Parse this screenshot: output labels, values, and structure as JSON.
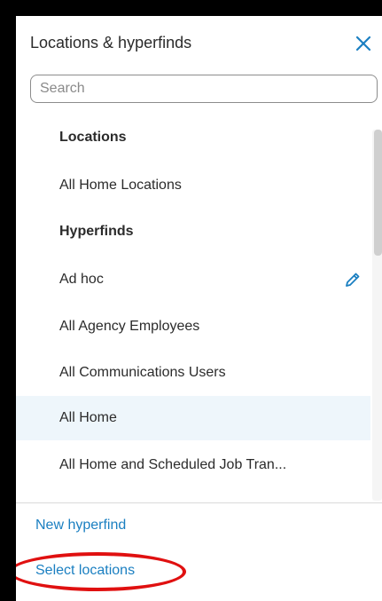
{
  "panel": {
    "title": "Locations & hyperfinds",
    "close_icon": "close-icon"
  },
  "search": {
    "placeholder": "Search",
    "value": ""
  },
  "list": {
    "locations_heading": "Locations",
    "all_home_locations": "All Home Locations",
    "hyperfinds_heading": "Hyperfinds",
    "ad_hoc": "Ad hoc",
    "ad_hoc_edit_icon": "pencil-icon",
    "all_agency_employees": "All Agency Employees",
    "all_communications_users": "All Communications Users",
    "all_home": "All Home",
    "all_home_and_scheduled": "All Home and Scheduled Job Tran..."
  },
  "footer": {
    "new_hyperfind": "New hyperfind",
    "select_locations": "Select locations"
  },
  "colors": {
    "accent": "#1a7fc1",
    "selected_row": "#eef6fb",
    "highlight_ring": "#e01010"
  }
}
